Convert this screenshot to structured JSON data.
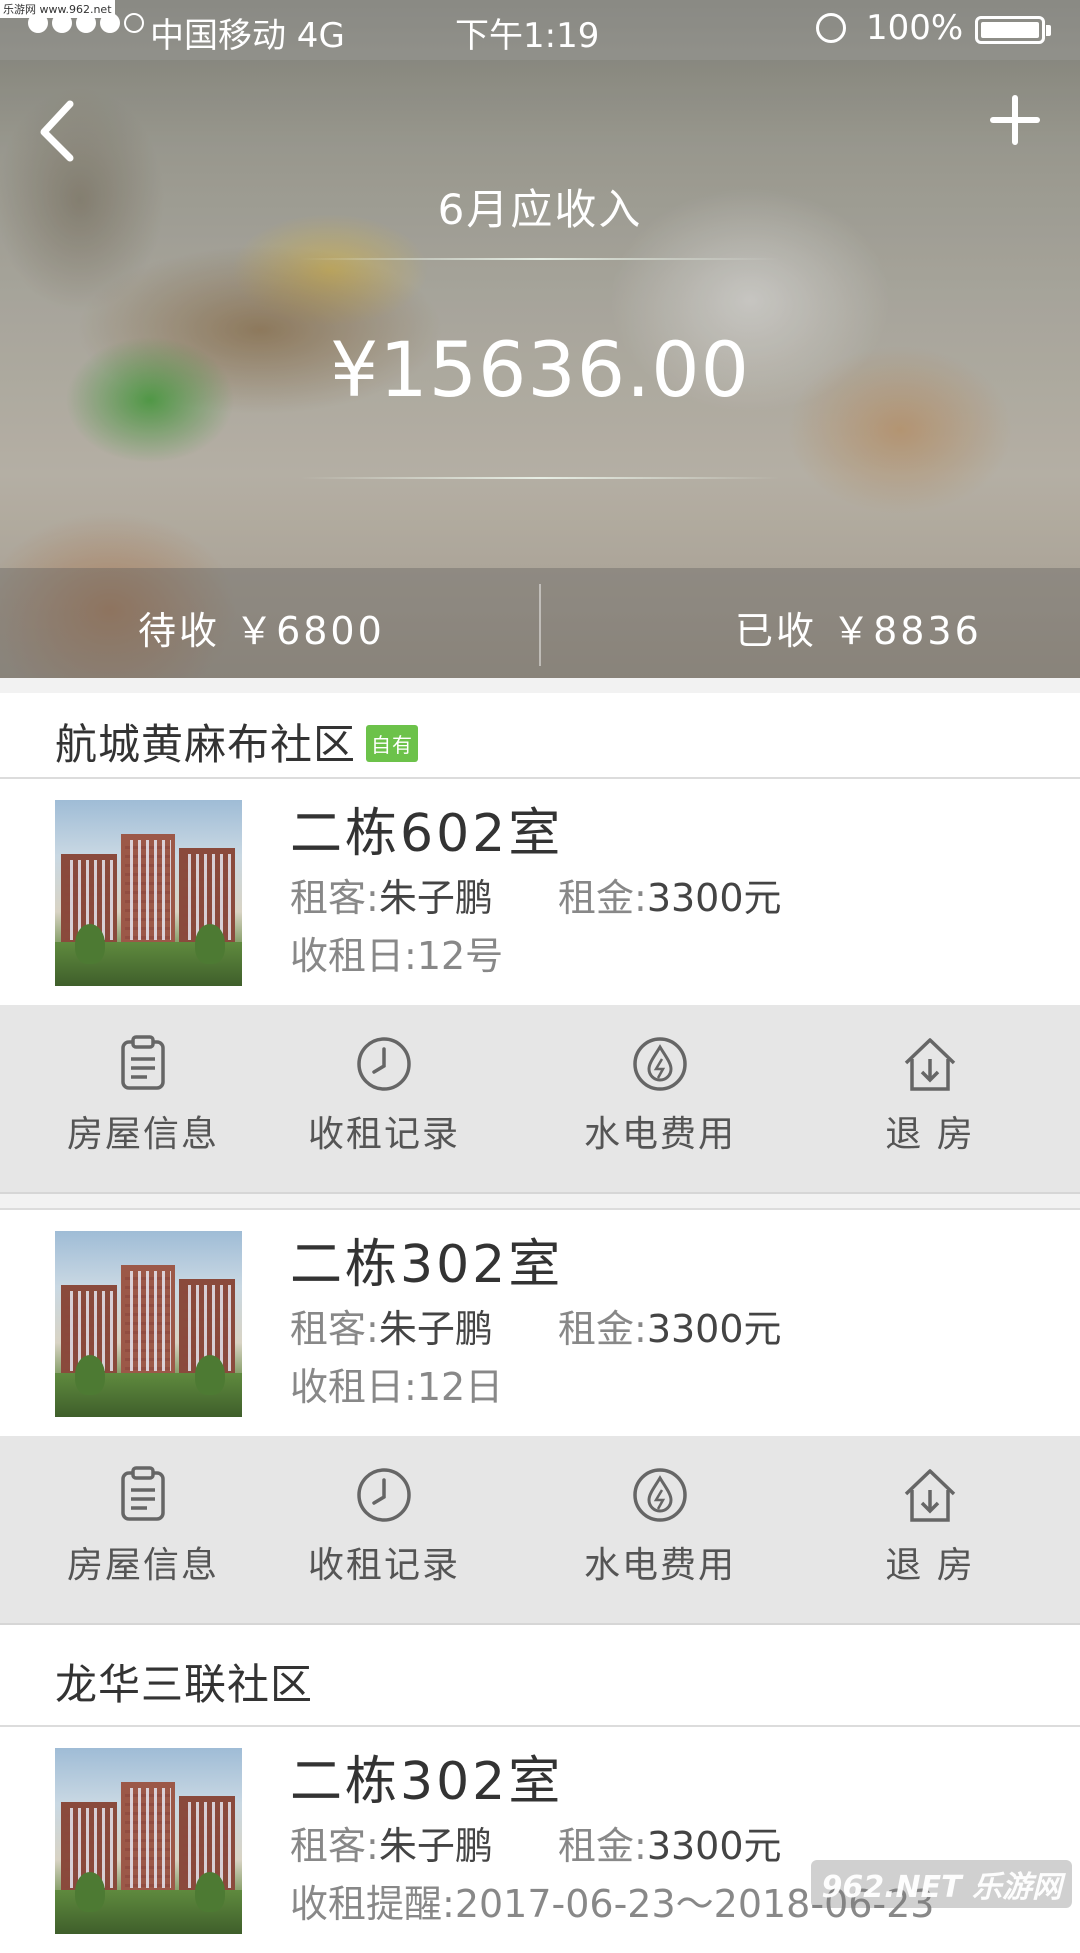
{
  "status_bar": {
    "carrier": "中国移动 4G",
    "time": "下午1:19",
    "battery_percent": "100%",
    "signal_bars_filled": 4,
    "signal_bars_total": 5
  },
  "watermark_top": "乐游网 www.962.net",
  "header": {
    "title": "6月应收入",
    "amount": "¥15636.00",
    "pending_label": "待收 ￥6800",
    "received_label": "已收 ￥8836"
  },
  "sections": [
    {
      "name": "航城黄麻布社区",
      "badge": "自有",
      "rooms": [
        {
          "title": "二栋602室",
          "tenant_label": "租客:",
          "tenant": "朱子鹏",
          "rent_label": "租金:",
          "rent": "3300元",
          "line2_label": "收租日:",
          "line2": "12号"
        },
        {
          "title": "二栋302室",
          "tenant_label": "租客:",
          "tenant": "朱子鹏",
          "rent_label": "租金:",
          "rent": "3300元",
          "line2_label": "收租日:",
          "line2": "12日"
        }
      ]
    },
    {
      "name": "龙华三联社区",
      "rooms": [
        {
          "title": "二栋302室",
          "tenant_label": "租客:",
          "tenant": "朱子鹏",
          "rent_label": "租金:",
          "rent": "3300元",
          "line2_label": "收租提醒:",
          "line2": "2017-06-23～2018-06-23"
        }
      ]
    }
  ],
  "actions": {
    "house_info": "房屋信息",
    "rent_records": "收租记录",
    "utilities": "水电费用",
    "checkout": "退 房"
  },
  "icons": {
    "back": "chevron-left-icon",
    "add": "plus-icon",
    "house_info": "clipboard-icon",
    "rent_records": "clock-icon",
    "utilities": "drop-bolt-icon",
    "checkout": "house-arrow-icon"
  },
  "colors": {
    "badge": "#6cc24a",
    "action_bar": "#e6e6e6"
  },
  "watermark": "962.NET 乐游网"
}
